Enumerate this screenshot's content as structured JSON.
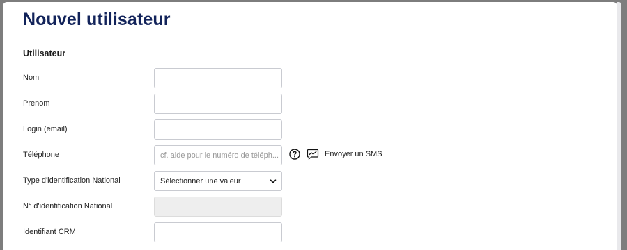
{
  "page": {
    "title": "Nouvel utilisateur"
  },
  "section": {
    "title": "Utilisateur"
  },
  "fields": {
    "nom": {
      "label": "Nom",
      "value": ""
    },
    "prenom": {
      "label": "Prenom",
      "value": ""
    },
    "login": {
      "label": "Login (email)",
      "value": ""
    },
    "telephone": {
      "label": "Téléphone",
      "placeholder": "cf. aide pour le numéro de téléph...",
      "sms_label": "Envoyer un SMS"
    },
    "type_id": {
      "label": "Type d'identification National",
      "selected": "Sélectionner une valeur"
    },
    "num_id": {
      "label": "N° d'identification National",
      "value": ""
    },
    "crm": {
      "label": "Identifiant CRM",
      "value": ""
    }
  },
  "icons": {
    "help": "help-circle-icon",
    "sms": "sms-message-icon",
    "chevron": "chevron-down-icon"
  },
  "colors": {
    "title": "#12235a",
    "border": "#c9cbd1",
    "disabled": "#eeeeee"
  }
}
